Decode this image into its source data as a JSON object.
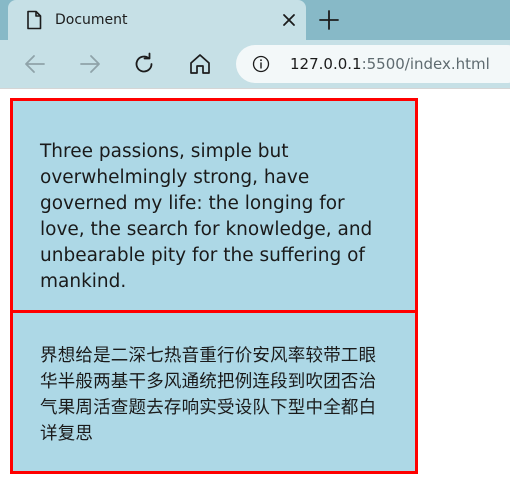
{
  "browser": {
    "tab_title": "Document",
    "url_host": "127.0.0.1",
    "url_rest": ":5500/index.html"
  },
  "page": {
    "paragraph_en": "Three passions, simple but overwhelmingly strong, have governed my life: the longing for love, the search for knowledge, and unbearable pity for the suffering of mankind.",
    "paragraph_zh": "界想给是二深七热音重行价安风率较带工眼华半般两基干多风通统把例连段到吹团否治气果周活查题去存响实受设队下型中全都白详复思"
  },
  "colors": {
    "box_background": "#add8e6",
    "box_border": "#ff0000",
    "tabbar": "#87b9c7",
    "toolbar": "#c6e0e6"
  }
}
